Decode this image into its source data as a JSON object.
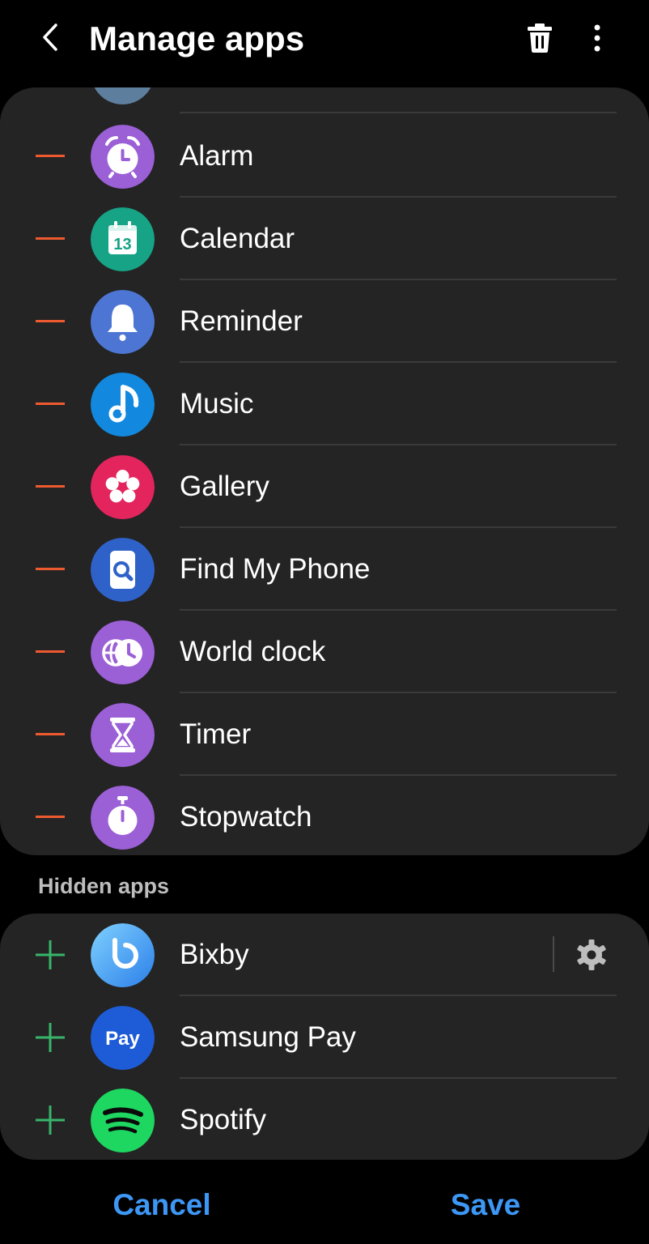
{
  "header": {
    "title": "Manage apps",
    "back_icon": "back-arrow-icon",
    "trash_icon": "trash-icon",
    "more_icon": "more-options-icon"
  },
  "visible_apps": [
    {
      "label": "",
      "icon": "settings-icon",
      "color": "#5e7e9e"
    },
    {
      "label": "Alarm",
      "icon": "alarm-icon",
      "color": "#9b5fd6"
    },
    {
      "label": "Calendar",
      "icon": "calendar-icon",
      "color": "#16a386",
      "day": "13"
    },
    {
      "label": "Reminder",
      "icon": "reminder-icon",
      "color": "#4d76d4"
    },
    {
      "label": "Music",
      "icon": "music-icon",
      "color": "#1289de"
    },
    {
      "label": "Gallery",
      "icon": "gallery-icon",
      "color": "#e3245d"
    },
    {
      "label": "Find My Phone",
      "icon": "find-my-phone-icon",
      "color": "#2f62c9"
    },
    {
      "label": "World clock",
      "icon": "world-clock-icon",
      "color": "#9b5fd6"
    },
    {
      "label": "Timer",
      "icon": "timer-icon",
      "color": "#9b5fd6"
    },
    {
      "label": "Stopwatch",
      "icon": "stopwatch-icon",
      "color": "#9b5fd6"
    }
  ],
  "hidden_section": {
    "title": "Hidden apps"
  },
  "hidden_apps": [
    {
      "label": "Bixby",
      "icon": "bixby-icon",
      "color": "#42a5f5",
      "has_settings": true
    },
    {
      "label": "Samsung Pay",
      "icon": "samsung-pay-icon",
      "color": "#1e5bd6",
      "text": "Pay"
    },
    {
      "label": "Spotify",
      "icon": "spotify-icon",
      "color": "#1ed760"
    }
  ],
  "footer": {
    "cancel_label": "Cancel",
    "save_label": "Save"
  },
  "colors": {
    "remove": "#ee5a2f",
    "add": "#38b56a",
    "accent": "#3d97f5",
    "card": "#242424"
  }
}
